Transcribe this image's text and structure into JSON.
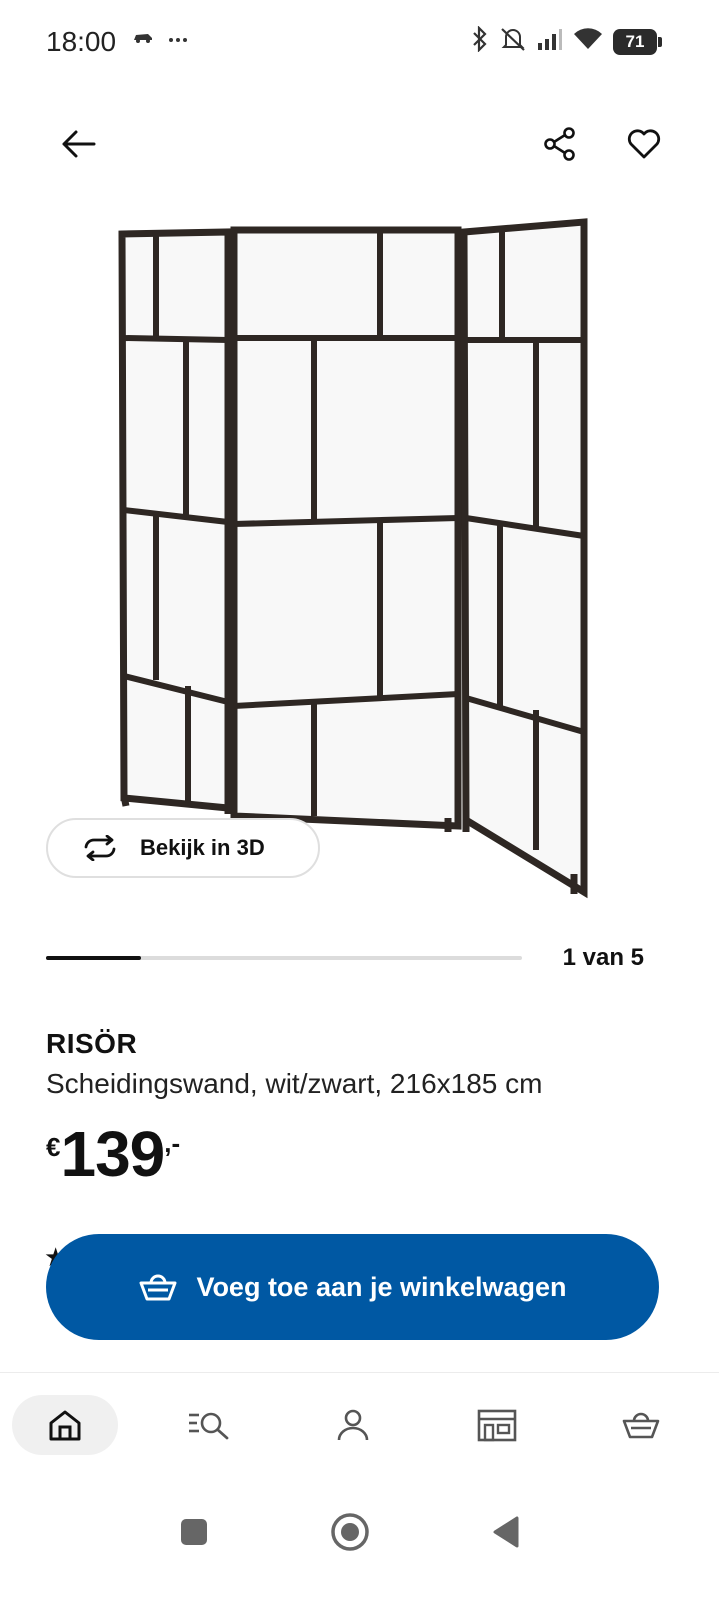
{
  "status_bar": {
    "time": "18:00",
    "battery": "71",
    "icons": [
      "car-icon",
      "more-dots-icon",
      "bluetooth-icon",
      "muted-bell-icon",
      "signal-icon",
      "wifi-icon"
    ]
  },
  "product": {
    "name": "RISÖR",
    "description": "Scheidingswand, wit/zwart, 216x185 cm",
    "price_currency": "€",
    "price_amount": "139",
    "price_suffix": ",-",
    "view_3d_label": "Bekijk in 3D"
  },
  "carousel": {
    "counter": "1 van 5",
    "progress": 0.2
  },
  "actions": {
    "add_to_cart": "Voeg toe aan je winkelwagen"
  },
  "bottom_nav": {
    "items": [
      {
        "icon": "home-icon",
        "active": true
      },
      {
        "icon": "search-list-icon",
        "active": false
      },
      {
        "icon": "profile-icon",
        "active": false
      },
      {
        "icon": "store-icon",
        "active": false
      },
      {
        "icon": "cart-icon",
        "active": false
      }
    ]
  },
  "colors": {
    "primary_button": "#0058a3",
    "frame": "#2e2723",
    "panel": "#f7f7f7"
  }
}
